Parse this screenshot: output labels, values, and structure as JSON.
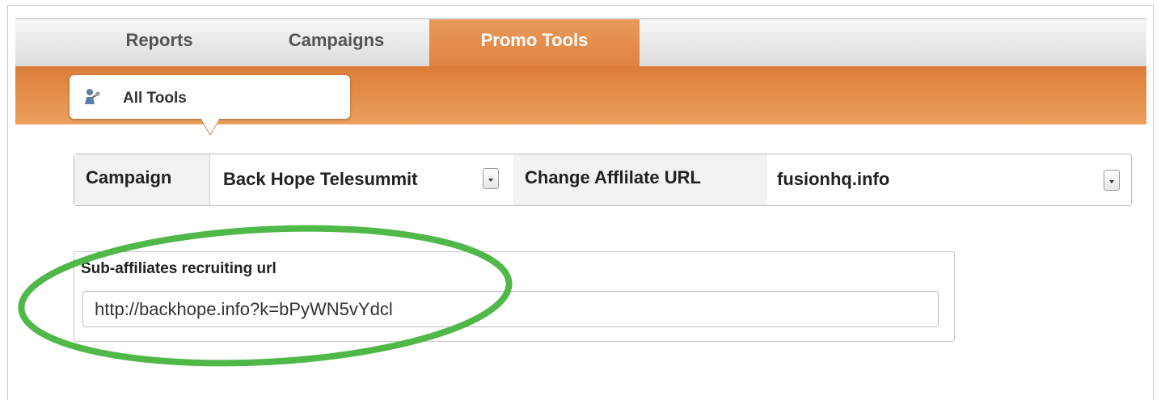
{
  "nav": {
    "tabs": [
      {
        "label": "Reports"
      },
      {
        "label": "Campaigns"
      },
      {
        "label": "Promo Tools"
      }
    ],
    "active_tab": "Promo Tools",
    "subtab": {
      "label": "All Tools",
      "icon": "tools-person-icon"
    }
  },
  "filters": {
    "campaign_label": "Campaign",
    "campaign_value": "Back Hope Telesummit",
    "affiliate_url_label": "Change Afflilate URL",
    "affiliate_url_value": "fusionhq.info"
  },
  "recruiting": {
    "title": "Sub-affiliates recruiting url",
    "url": "http://backhope.info?k=bPyWN5vYdcl"
  },
  "colors": {
    "accent_orange": "#de8240",
    "annotation_green": "#4fb848"
  }
}
